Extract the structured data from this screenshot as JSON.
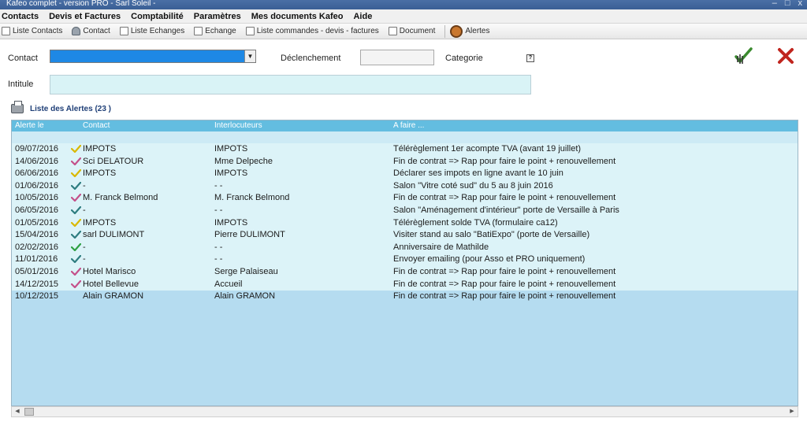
{
  "window": {
    "title": "Kafeo complet - version PRO -  Sarl Soleil  -",
    "minimize": "–",
    "maximize": "□",
    "close": "x"
  },
  "menu": [
    "Contacts",
    "Devis et Factures",
    "Comptabilité",
    "Paramètres",
    "Mes documents Kafeo",
    "Aide"
  ],
  "toolbar": {
    "items": [
      "Liste Contacts",
      "Contact",
      "Liste Echanges",
      "Echange",
      "Liste commandes - devis - factures",
      "Document",
      "Alertes"
    ]
  },
  "form": {
    "contact_label": "Contact",
    "declenchement_label": "Déclenchement",
    "categorie_label": "Categorie",
    "categorie_button": "?",
    "intitule_label": "Intitule",
    "contact_arrow": "▼"
  },
  "list": {
    "title": "Liste des Alertes (23 )",
    "columns": [
      "Alerte le",
      "Contact",
      "Interlocuteurs",
      "A faire ..."
    ],
    "rows": [
      {
        "date": "09/07/2016",
        "check": "yellow",
        "contact": "IMPOTS",
        "inter": "IMPOTS",
        "todo": "Télérèglement 1er acompte TVA (avant 19 juillet)"
      },
      {
        "date": "14/06/2016",
        "check": "pink",
        "contact": "Sci DELATOUR",
        "inter": "Mme Delpeche",
        "todo": "Fin de contrat => Rap pour faire le point + renouvellement"
      },
      {
        "date": "06/06/2016",
        "check": "yellow",
        "contact": "IMPOTS",
        "inter": "IMPOTS",
        "todo": "Déclarer ses impots en ligne avant le 10 juin"
      },
      {
        "date": "01/06/2016",
        "check": "teal",
        "contact": "-",
        "inter": "- -",
        "todo": "Salon \"Vitre coté sud\" du 5 au 8 juin 2016"
      },
      {
        "date": "10/05/2016",
        "check": "pink",
        "contact": "M. Franck Belmond",
        "inter": "M. Franck Belmond",
        "todo": "Fin de contrat => Rap pour faire le point + renouvellement"
      },
      {
        "date": "06/05/2016",
        "check": "teal",
        "contact": "-",
        "inter": "- -",
        "todo": "Salon \"Aménagement d'intérieur\" porte de Versaille à Paris"
      },
      {
        "date": "01/05/2016",
        "check": "yellow",
        "contact": "IMPOTS",
        "inter": "IMPOTS",
        "todo": "Télérèglement solde TVA (formulaire ca12)"
      },
      {
        "date": "15/04/2016",
        "check": "teal",
        "contact": "sarl DULIMONT",
        "inter": "Pierre DULIMONT",
        "todo": "Visiter stand au salo \"BatiExpo\" (porte de Versaille)"
      },
      {
        "date": "02/02/2016",
        "check": "green",
        "contact": "-",
        "inter": "- -",
        "todo": "Anniversaire  de  Mathilde"
      },
      {
        "date": "11/01/2016",
        "check": "teal",
        "contact": "-",
        "inter": "- -",
        "todo": "Envoyer emailing  (pour Asso et PRO uniquement)"
      },
      {
        "date": "05/01/2016",
        "check": "pink",
        "contact": "Hotel Marisco",
        "inter": "Serge Palaiseau",
        "todo": "Fin de contrat => Rap pour faire le point + renouvellement"
      },
      {
        "date": "14/12/2015",
        "check": "pink",
        "contact": "Hotel Bellevue",
        "inter": "Accueil",
        "todo": "Fin de contrat => Rap pour faire le point + renouvellement"
      },
      {
        "date": "10/12/2015",
        "check": "none",
        "contact": "Alain GRAMON",
        "inter": "Alain GRAMON",
        "todo": "Fin de contrat => Rap pour faire le point + renouvellement"
      }
    ]
  },
  "colors": {
    "yellow": "#d9b800",
    "pink": "#c4508a",
    "teal": "#2e7d80",
    "green": "#2ea043"
  },
  "scroll": {
    "left": "◀",
    "right": "▶"
  }
}
